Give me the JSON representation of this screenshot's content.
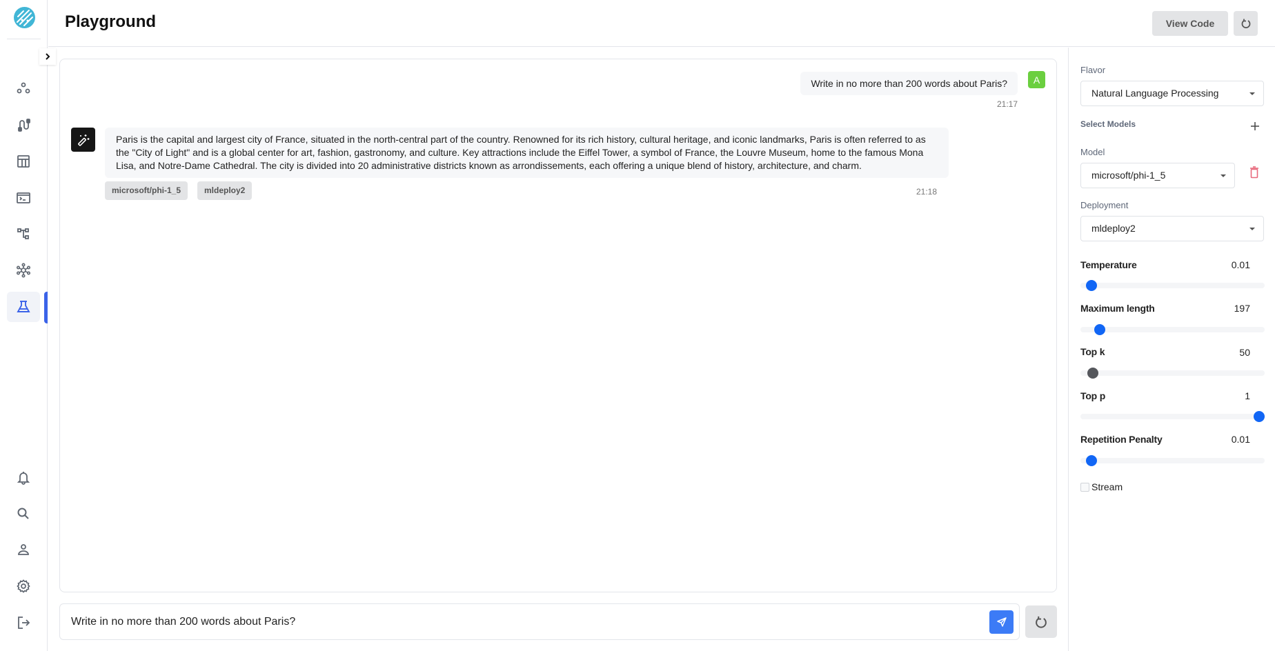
{
  "app": {
    "title": "Playground"
  },
  "sidebar": {
    "logo": "brand-logo",
    "items": [
      {
        "name": "projects",
        "icon": "circles-icon",
        "active": false
      },
      {
        "name": "pipelines",
        "icon": "route-icon",
        "active": false
      },
      {
        "name": "datasets",
        "icon": "table-icon",
        "active": false
      },
      {
        "name": "terminal",
        "icon": "terminal-icon",
        "active": false
      },
      {
        "name": "workflows",
        "icon": "hierarchy-icon",
        "active": false
      },
      {
        "name": "models",
        "icon": "network-icon",
        "active": false
      },
      {
        "name": "playground",
        "icon": "flask-icon",
        "active": true
      }
    ],
    "bottom_items": [
      {
        "name": "notifications",
        "icon": "bell-icon"
      },
      {
        "name": "search",
        "icon": "search-icon"
      },
      {
        "name": "profile",
        "icon": "user-icon"
      },
      {
        "name": "settings",
        "icon": "gear-icon"
      },
      {
        "name": "logout",
        "icon": "logout-icon"
      }
    ]
  },
  "header": {
    "view_code_label": "View Code"
  },
  "chat": {
    "messages": [
      {
        "role": "user",
        "avatar": "A",
        "text": "Write in no more than 200 words about Paris?",
        "time": "21:17"
      },
      {
        "role": "assistant",
        "text": "Paris is the capital and largest city of France, situated in the north-central part of the country. Renowned for its rich history, cultural heritage, and iconic landmarks, Paris is often referred to as the \"City of Light\" and is a global center for art, fashion, gastronomy, and culture. Key attractions include the Eiffel Tower, a symbol of France, the Louvre Museum, home to the famous Mona Lisa, and Notre-Dame Cathedral. The city is divided into 20 administrative districts known as arrondissements, each offering a unique blend of history, architecture, and charm.",
        "tags": [
          "microsoft/phi-1_5",
          "mldeploy2"
        ],
        "time": "21:18"
      }
    ],
    "input": {
      "value": "Write in no more than 200 words about Paris?",
      "placeholder": ""
    }
  },
  "settings": {
    "flavor_label": "Flavor",
    "flavor_value": "Natural Language Processing",
    "select_models_label": "Select Models",
    "model_label": "Model",
    "model_value": "microsoft/phi-1_5",
    "deployment_label": "Deployment",
    "deployment_value": "mldeploy2",
    "params": [
      {
        "label": "Temperature",
        "value": "0.01",
        "fraction": 0.03
      },
      {
        "label": "Maximum length",
        "value": "197",
        "fraction": 0.08
      },
      {
        "label": "Top k",
        "value": "50",
        "fraction": 0.04
      },
      {
        "label": "Top p",
        "value": "1",
        "fraction": 1.0
      },
      {
        "label": "Repetition Penalty",
        "value": "0.01",
        "fraction": 0.03
      }
    ],
    "stream_label": "Stream",
    "stream_checked": false
  },
  "colors": {
    "accent": "#3b63e8",
    "send_button": "#3c7bf6",
    "slider_thumb": "#1166f5",
    "user_avatar": "#6bcf3f",
    "logo": "#41b6d6",
    "delete": "#e8697c"
  }
}
